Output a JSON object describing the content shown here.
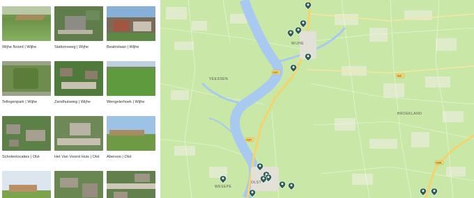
{
  "projects": [
    {
      "caption": "Wijhe Noord | Wijhe",
      "scene": "field"
    },
    {
      "caption": "Stationsweg | Wijhe",
      "scene": "aerial-town"
    },
    {
      "caption": "Beatrixlaan | Wijhe",
      "scene": "street"
    },
    {
      "caption": "Tellegenpark | Wijhe",
      "scene": "park"
    },
    {
      "caption": "Zandhuisweg | Wijhe",
      "scene": "aerial-green"
    },
    {
      "caption": "Wengelerhoek | Wijhe",
      "scene": "meadow"
    },
    {
      "caption": "Scholenlocaties | Olst",
      "scene": "aerial-village"
    },
    {
      "caption": "Het Van Voorst Huis | Olst",
      "scene": "aerial-building"
    },
    {
      "caption": "Aberson | Olst",
      "scene": "sky-field"
    },
    {
      "caption": "",
      "scene": "sky-field2"
    },
    {
      "caption": "",
      "scene": "aerial-town2"
    },
    {
      "caption": "",
      "scene": "aerial-street"
    }
  ],
  "map": {
    "labels": {
      "wijhe": "WIJHE",
      "veessen": "VEESSEN",
      "broekland": "BROEKLAND",
      "olst": "OLST",
      "wesepe": "WESEPE"
    },
    "road_badges": {
      "n337_north": "N337",
      "n337_south": "N337",
      "n35": "N35",
      "a1": "N348"
    },
    "colors": {
      "land": "#c9e8a7",
      "water": "#a8c9f0",
      "road_major": "#f5d36b",
      "marker": "#2e5e54"
    },
    "markers": [
      {
        "name": "marker-1"
      },
      {
        "name": "marker-2"
      },
      {
        "name": "marker-3"
      },
      {
        "name": "marker-4"
      },
      {
        "name": "marker-5"
      },
      {
        "name": "marker-6"
      },
      {
        "name": "marker-7"
      },
      {
        "name": "marker-8"
      },
      {
        "name": "marker-9"
      },
      {
        "name": "marker-10"
      },
      {
        "name": "marker-11"
      },
      {
        "name": "marker-12"
      },
      {
        "name": "marker-13"
      },
      {
        "name": "marker-14"
      },
      {
        "name": "marker-15"
      },
      {
        "name": "marker-16"
      }
    ]
  }
}
